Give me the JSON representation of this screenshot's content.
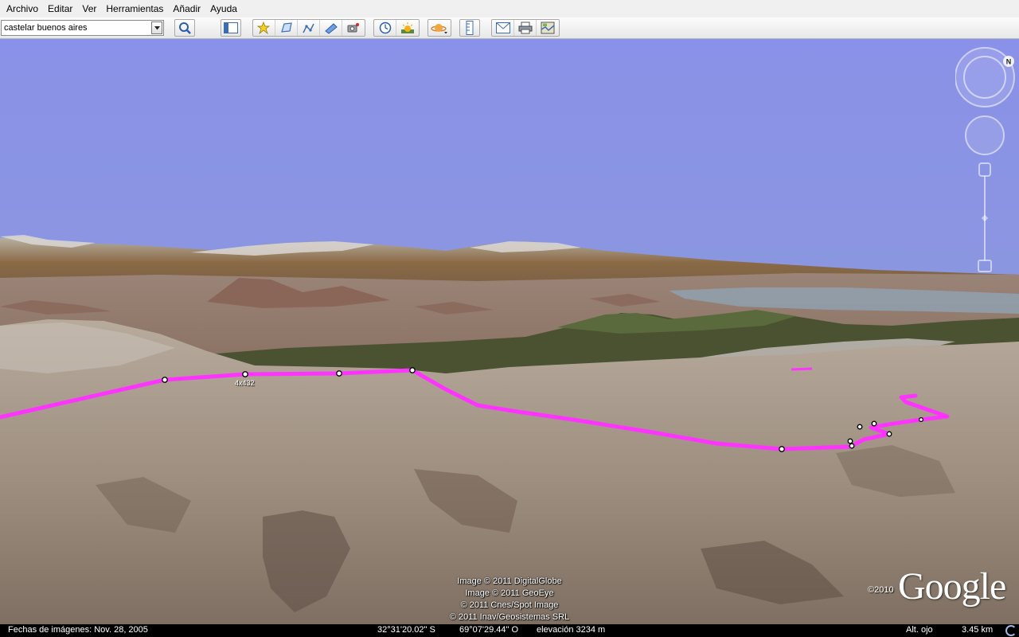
{
  "menu": {
    "items": [
      "Archivo",
      "Editar",
      "Ver",
      "Herramientas",
      "Añadir",
      "Ayuda"
    ]
  },
  "toolbar": {
    "search_value": "castelar buenos aires",
    "icons": [
      "search-icon",
      "sidebar-icon",
      "placemark-icon",
      "polygon-icon",
      "path-icon",
      "overlay-icon",
      "tour-icon",
      "history-icon",
      "sunlight-icon",
      "planet-icon",
      "ruler-icon",
      "email-icon",
      "print-icon",
      "map-icon"
    ]
  },
  "map": {
    "path_label": "4x432",
    "path_color": "#ff33ff",
    "sky_color": "#8a93e6",
    "attribution": [
      "Image © 2011 DigitalGlobe",
      "Image © 2011 GeoEye",
      "© 2011 Cnes/Spot Image",
      "© 2011 Inav/Geosistemas SRL"
    ],
    "copyright_year": "©2010",
    "logo": "Google",
    "compass_north": "N"
  },
  "status": {
    "imagery_date": "Fechas de imágenes: Nov. 28, 2005",
    "latitude": "32°31'20.02\" S",
    "longitude": "69°07'29.44\" O",
    "elevation": "elevación 3234 m",
    "eye_alt_label": "Alt. ojo",
    "eye_alt_value": "3.45 km"
  }
}
